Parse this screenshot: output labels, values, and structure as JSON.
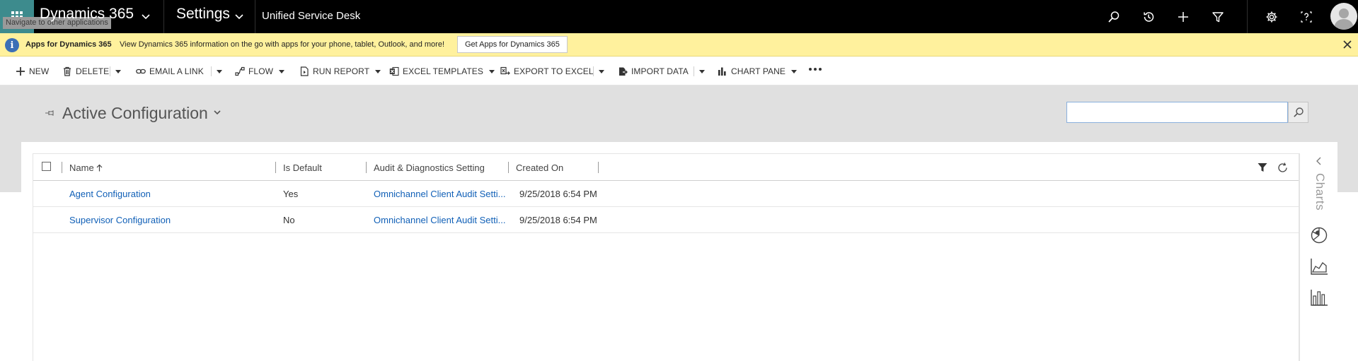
{
  "nav": {
    "tooltip": "Navigate to other applications",
    "app_name": "Dynamics 365",
    "area_name": "Settings",
    "entity_name": "Unified Service Desk",
    "icons": [
      "search-icon",
      "history-icon",
      "plus-icon",
      "filter-icon",
      "settings-icon",
      "help-icon",
      "user-avatar"
    ]
  },
  "notification": {
    "title": "Apps for Dynamics 365",
    "message": "View Dynamics 365 information on the go with apps for your phone, tablet, Outlook, and more!",
    "button": "Get Apps for Dynamics 365"
  },
  "commands": {
    "new": "NEW",
    "delete": "DELETE",
    "email_link": "EMAIL A LINK",
    "flow": "FLOW",
    "run_report": "RUN REPORT",
    "excel_templates": "EXCEL TEMPLATES",
    "export_excel": "EXPORT TO EXCEL",
    "import_data": "IMPORT DATA",
    "chart_pane": "CHART PANE"
  },
  "view": {
    "title": "Active Configuration",
    "search_value": ""
  },
  "grid": {
    "columns": [
      "Name",
      "Is Default",
      "Audit & Diagnostics Setting",
      "Created On"
    ],
    "sort_column": "Name",
    "sort_direction": "ascending",
    "rows": [
      {
        "name": "Agent Configuration",
        "is_default": "Yes",
        "audit": "Omnichannel Client Audit Setti...",
        "created_on": "9/25/2018 6:54 PM"
      },
      {
        "name": "Supervisor Configuration",
        "is_default": "No",
        "audit": "Omnichannel Client Audit Setti...",
        "created_on": "9/25/2018 6:54 PM"
      }
    ]
  },
  "charts_rail": {
    "label": "Charts",
    "icons": [
      "pie-chart-icon",
      "area-chart-icon",
      "bar-chart-icon"
    ]
  },
  "colors": {
    "waffle": "#3d8b8d",
    "notification_bg": "#fff19d",
    "link": "#1160b7",
    "band": "#e0e0e0"
  }
}
